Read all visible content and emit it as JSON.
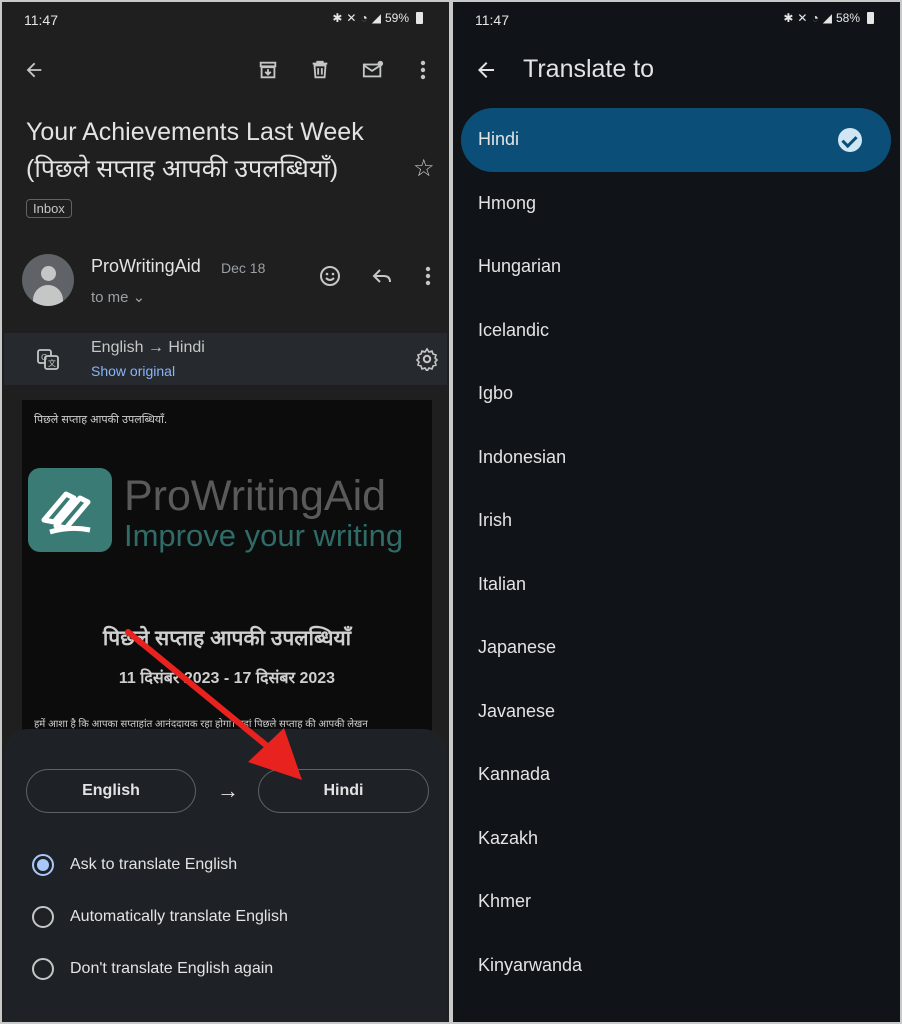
{
  "left": {
    "status": {
      "time": "11:47",
      "battery": "59%"
    },
    "subject": "Your Achievements Last Week (पिछले सप्ताह आपकी उपलब्धियाँ)",
    "label_chip": "Inbox",
    "sender": {
      "name": "ProWritingAid",
      "date": "Dec 18",
      "to": "to me ⌄"
    },
    "translate_bar": {
      "langs": "English → Hindi",
      "show_original": "Show original"
    },
    "email": {
      "preheader": "पिछले सप्ताह आपकी उपलब्धियाँ.",
      "brand": "ProWritingAid",
      "tagline": "Improve your writing",
      "title": "पिछले सप्ताह आपकी उपलब्धियाँ",
      "date_range": "11 दिसंबर 2023 - 17 दिसंबर 2023",
      "paragraph": "हमें आशा है कि आपका सप्ताहांत आनंददायक रहा होगा। यहां पिछले सप्ताह की आपकी लेखन"
    },
    "sheet": {
      "from_lang": "English",
      "arrow": "→",
      "to_lang": "Hindi",
      "options": [
        {
          "label": "Ask to translate English",
          "selected": true
        },
        {
          "label": "Automatically translate English",
          "selected": false
        },
        {
          "label": "Don't translate English again",
          "selected": false
        }
      ]
    },
    "colors": {
      "annotation_arrow": "#e8231f"
    }
  },
  "right": {
    "status": {
      "time": "11:47",
      "battery": "58%"
    },
    "title": "Translate to",
    "languages": [
      "Hindi",
      "Hmong",
      "Hungarian",
      "Icelandic",
      "Igbo",
      "Indonesian",
      "Irish",
      "Italian",
      "Japanese",
      "Javanese",
      "Kannada",
      "Kazakh",
      "Khmer",
      "Kinyarwanda"
    ],
    "selected_language": "Hindi",
    "accent": "#0b4f78"
  }
}
